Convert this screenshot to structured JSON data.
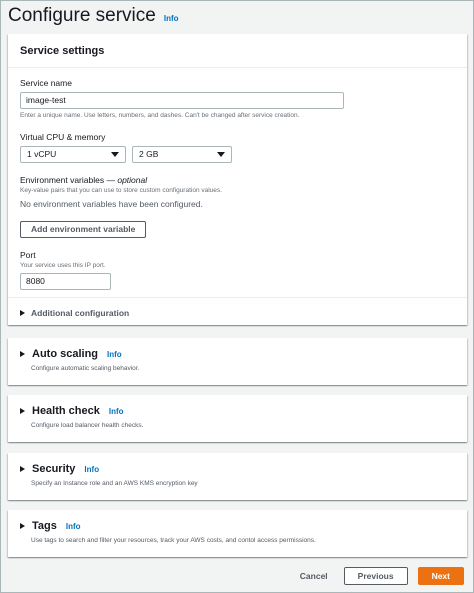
{
  "page": {
    "title": "Configure service",
    "info": "Info"
  },
  "service_settings": {
    "header": "Service settings",
    "service_name": {
      "label": "Service name",
      "value": "image-test",
      "description": "Enter a unique name. Use letters, numbers, and dashes. Can't be changed after service creation."
    },
    "cpu_memory": {
      "label": "Virtual CPU & memory",
      "cpu_value": "1 vCPU",
      "memory_value": "2 GB"
    },
    "env_vars": {
      "label": "Environment variables",
      "label_suffix": "optional",
      "description": "Key-value pairs that you can use to store custom configuration values.",
      "empty_text": "No environment variables have been configured.",
      "add_button": "Add environment variable"
    },
    "port": {
      "label": "Port",
      "description": "Your service uses this IP port.",
      "value": "8080"
    },
    "additional": "Additional configuration"
  },
  "sections": [
    {
      "title": "Auto scaling",
      "info": "Info",
      "subtitle": "Configure automatic scaling behavior."
    },
    {
      "title": "Health check",
      "info": "Info",
      "subtitle": "Configure load balancer health checks."
    },
    {
      "title": "Security",
      "info": "Info",
      "subtitle": "Specify an Instance role and an AWS KMS encryption key"
    },
    {
      "title": "Tags",
      "info": "Info",
      "subtitle": "Use tags to search and filter your resources, track your AWS costs, and contol access permissions."
    }
  ],
  "footer": {
    "cancel": "Cancel",
    "previous": "Previous",
    "next": "Next"
  },
  "colors": {
    "primary": "#ec7211",
    "link": "#0073bb",
    "background": "#f2f3f3"
  }
}
